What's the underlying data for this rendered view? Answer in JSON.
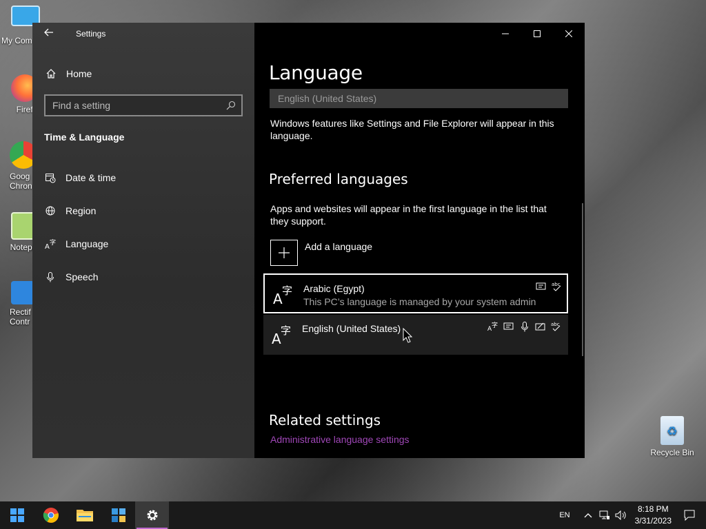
{
  "desktop": {
    "icons": [
      {
        "label": "My Com",
        "color": "#3aa0e0"
      },
      {
        "label": "Firefo",
        "color": "#e8663a"
      },
      {
        "label": "Goog Chron",
        "color": "#3d8be6"
      },
      {
        "label": "Notepa",
        "color": "#7cc24a"
      },
      {
        "label": "Rectif Contr",
        "color": "#2f7dd6"
      }
    ],
    "recycle_bin": "Recycle Bin"
  },
  "window": {
    "title": "Settings",
    "back_icon": "back-arrow-icon",
    "controls": [
      "minimize",
      "maximize",
      "close"
    ]
  },
  "sidebar": {
    "home_label": "Home",
    "search_placeholder": "Find a setting",
    "section_title": "Time & Language",
    "items": [
      {
        "label": "Date & time",
        "icon": "calendar-clock-icon"
      },
      {
        "label": "Region",
        "icon": "globe-icon"
      },
      {
        "label": "Language",
        "icon": "language-icon"
      },
      {
        "label": "Speech",
        "icon": "microphone-icon"
      }
    ]
  },
  "main": {
    "title": "Language",
    "display_language_value": "English (United States)",
    "display_language_desc": "Windows features like Settings and File Explorer will appear in this language.",
    "preferred_heading": "Preferred languages",
    "preferred_desc": "Apps and websites will appear in the first language in the list that they support.",
    "add_language_label": "Add a language",
    "languages": [
      {
        "name": "Arabic (Egypt)",
        "sub": "This PC’s language is managed by your system admin",
        "selected": true
      },
      {
        "name": "English (United States)",
        "sub": "",
        "selected": false
      }
    ],
    "related_heading": "Related settings",
    "related_link": "Administrative language settings"
  },
  "taskbar": {
    "input_lang": "EN",
    "time": "8:18 PM",
    "date": "3/31/2023",
    "accent": "#c06ad0"
  }
}
